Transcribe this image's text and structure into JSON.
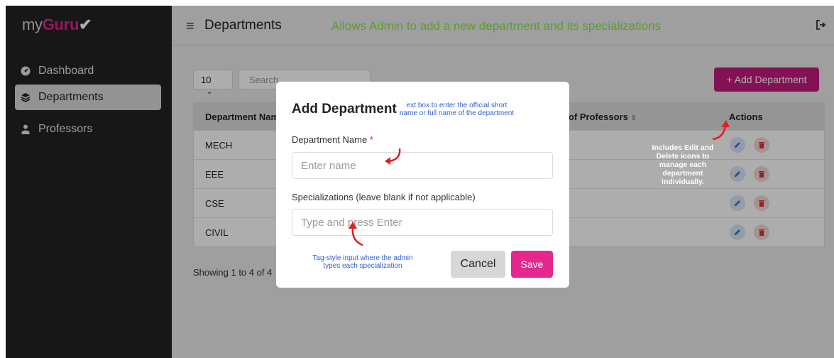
{
  "app": {
    "logo_prefix": "my",
    "logo_brand": "Guru",
    "logo_mark": "✔"
  },
  "sidebar": {
    "items": [
      {
        "label": "Dashboard",
        "icon": "dashboard-icon"
      },
      {
        "label": "Departments",
        "icon": "layers-icon",
        "active": true
      },
      {
        "label": "Professors",
        "icon": "professor-icon"
      }
    ]
  },
  "header": {
    "title": "Departments",
    "annotation": "Allows Admin to add a new department and its specializations"
  },
  "toolbar": {
    "page_length": "10",
    "search_placeholder": "Search",
    "add_button": "+ Add Department"
  },
  "table": {
    "columns": [
      "Department Name",
      "of Professors",
      "Actions"
    ],
    "rows": [
      "MECH",
      "EEE",
      "CSE",
      "CIVIL"
    ]
  },
  "footer": {
    "showing": "Showing 1 to 4 of 4"
  },
  "modal": {
    "title": "Add Department",
    "name_label": "Department Name",
    "required_mark": "*",
    "name_placeholder": "Enter name",
    "spec_label": "Specializations (leave blank if not applicable)",
    "spec_placeholder": "Type and press Enter",
    "cancel": "Cancel",
    "save": "Save"
  },
  "annotations": {
    "name_box_line1": "ext box to enter the official short",
    "name_box_line2": "name or full name of the department",
    "tag_line1": "Tag-style input where the admin",
    "tag_line2": "types each specialization",
    "actions_1": "Includes Edit  and",
    "actions_2": "Delete  icons to",
    "actions_3": "manage each",
    "actions_4": "department",
    "actions_5": "individually."
  },
  "colors": {
    "brand": "#e91e8c",
    "save": "#e6278e",
    "add_button": "#c21b7e",
    "annotation_green": "#8ce44a",
    "annotation_blue": "#2f5ed0"
  }
}
